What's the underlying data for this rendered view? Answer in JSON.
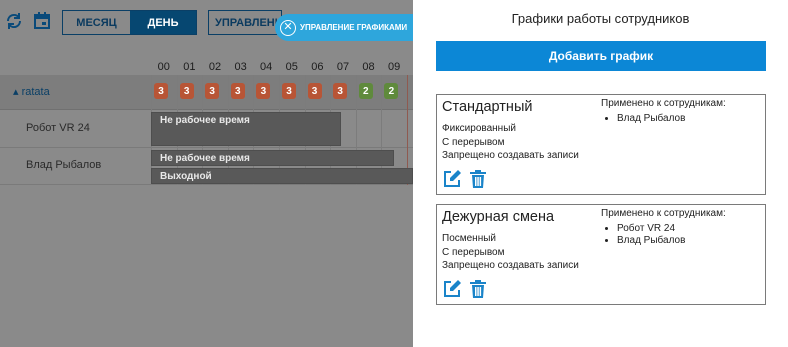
{
  "toolbar": {
    "month_label": "МЕСЯЦ",
    "day_label": "ДЕНЬ",
    "manage_label": "УПРАВЛЕНИЕ",
    "manage_pill_label": "УПРАВЛЕНИЕ ГРАФИКАМИ"
  },
  "scheduler": {
    "hours": [
      "00",
      "01",
      "02",
      "03",
      "04",
      "05",
      "06",
      "07",
      "08",
      "09"
    ],
    "group": {
      "name": "ratata",
      "counts": [
        {
          "value": "3",
          "color": "red"
        },
        {
          "value": "3",
          "color": "red"
        },
        {
          "value": "3",
          "color": "red"
        },
        {
          "value": "3",
          "color": "red"
        },
        {
          "value": "3",
          "color": "red"
        },
        {
          "value": "3",
          "color": "red"
        },
        {
          "value": "3",
          "color": "red"
        },
        {
          "value": "3",
          "color": "red"
        },
        {
          "value": "2",
          "color": "green"
        },
        {
          "value": "2",
          "color": "green"
        }
      ]
    },
    "employees": [
      {
        "name": "Робот VR 24",
        "bars": [
          "Не рабочее время"
        ]
      },
      {
        "name": "Влад Рыбалов",
        "bars": [
          "Не рабочее время",
          "Выходной"
        ]
      }
    ]
  },
  "panel": {
    "title": "Графики работы сотрудников",
    "add_button": "Добавить график",
    "applied_label": "Применено к сотрудникам:",
    "schedules": [
      {
        "name": "Стандартный",
        "type": "Фиксированный",
        "break": "С перерывом",
        "restriction": "Запрещено создавать записи",
        "employees": [
          "Влад Рыбалов"
        ]
      },
      {
        "name": "Дежурная смена",
        "type": "Посменный",
        "break": "С перерывом",
        "restriction": "Запрещено создавать записи",
        "employees": [
          "Робот VR 24",
          "Влад Рыбалов"
        ]
      }
    ]
  },
  "colors": {
    "accent": "#0c87d6",
    "pill": "#2ea6dc",
    "badge_red": "#b85536",
    "badge_green": "#5f8a3c",
    "icon_blue": "#1a84c9"
  }
}
